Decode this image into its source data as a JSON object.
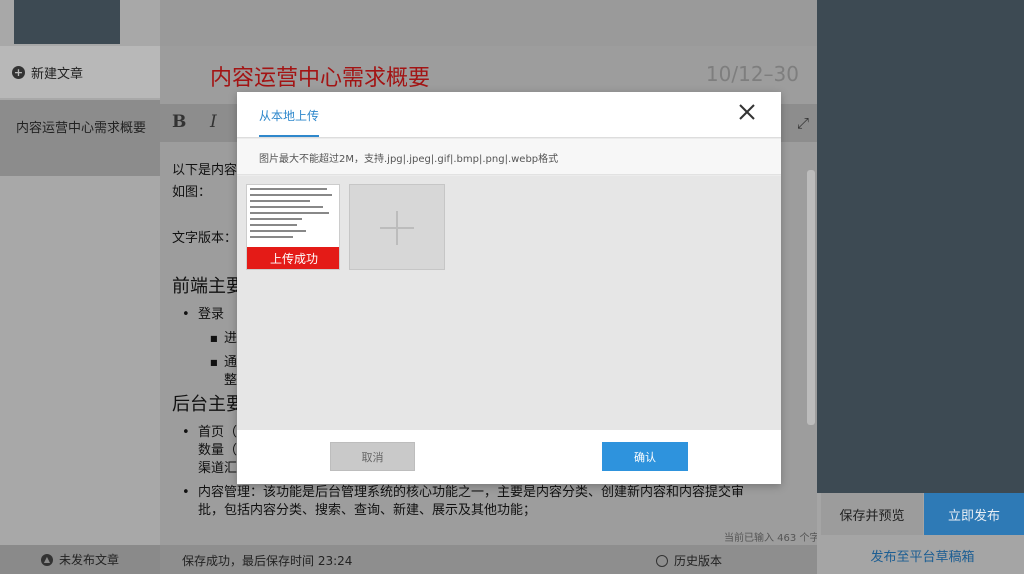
{
  "sidebar": {
    "new_article": "新建文章",
    "article_item": "内容运营中心需求概要",
    "unpublished": "未发布文章"
  },
  "editor": {
    "title": "内容运营中心需求概要",
    "date": "10/12–30",
    "toolbar": {
      "bold": "B",
      "italic": "I"
    },
    "body": {
      "intro": "以下是内容",
      "as_shown": "如图：",
      "text_version": "文字版本：",
      "frontend_heading": "前端主要",
      "login": "登录",
      "sub1": "进",
      "sub2": "通",
      "sub2_cont": "整",
      "backend_heading": "后台主要",
      "home_line1": "首页（",
      "home_line2": "数量（",
      "home_line3": "渠道汇",
      "content_mgmt_line1": "内容管理：该功能是后台管理系统的核心功能之一，主要是内容分类、创建新内容和内容提交审",
      "content_mgmt_line2": "批，包括内容分类、搜索、查询、新建、展示及其他功能；"
    },
    "word_count": "当前已输入 463 个字",
    "save_status": "保存成功，最后保存时间 23:24",
    "history": "历史版本"
  },
  "right_panel": {
    "save_preview": "保存并预览",
    "publish_now": "立即发布",
    "publish_draft": "发布至平台草稿箱"
  },
  "modal": {
    "tab": "从本地上传",
    "hint": "图片最大不能超过2M，支持.jpg|.jpeg|.gif|.bmp|.png|.webp格式",
    "upload_success": "上传成功",
    "cancel": "取消",
    "confirm": "确认"
  },
  "colors": {
    "title_red": "#a31414",
    "accent_blue": "#2e93dd",
    "success_red": "#e41b17",
    "dark_panel": "#3d4a53"
  }
}
